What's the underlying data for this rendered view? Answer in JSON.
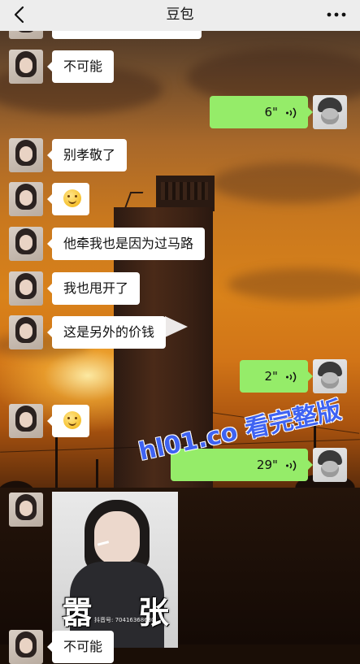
{
  "header": {
    "title": "豆包"
  },
  "icons": {
    "back": "chevron-left-icon",
    "more": "more-dots-icon",
    "voice": "voice-wave-icon",
    "emoji": "smile-emoji-icon"
  },
  "colors": {
    "topbar": "#ededed",
    "bubble_received": "#ffffff",
    "bubble_sent": "#95ec69",
    "watermark": "#3f63f2"
  },
  "messages": [
    {
      "side": "left",
      "type": "text",
      "text": ""
    },
    {
      "side": "left",
      "type": "text",
      "text": "不可能"
    },
    {
      "side": "right",
      "type": "voice",
      "duration": "6\""
    },
    {
      "side": "left",
      "type": "text",
      "text": "别孝敬了"
    },
    {
      "side": "left",
      "type": "emoji",
      "emoji": "smile"
    },
    {
      "side": "left",
      "type": "text",
      "text": "他牵我也是因为过马路"
    },
    {
      "side": "left",
      "type": "text",
      "text": "我也甩开了"
    },
    {
      "side": "left",
      "type": "text",
      "text": "这是另外的价钱"
    },
    {
      "side": "right",
      "type": "voice",
      "duration": "2\""
    },
    {
      "side": "left",
      "type": "emoji",
      "emoji": "smile"
    },
    {
      "side": "right",
      "type": "voice",
      "duration": "29\""
    },
    {
      "side": "left",
      "type": "sticker",
      "caption_left": "嚣",
      "caption_right": "张",
      "sticker_id_text": "抖音号: 70416368630"
    },
    {
      "side": "left",
      "type": "text",
      "text": "不可能"
    }
  ],
  "overlay_watermark": "hl01.co 看完整版"
}
